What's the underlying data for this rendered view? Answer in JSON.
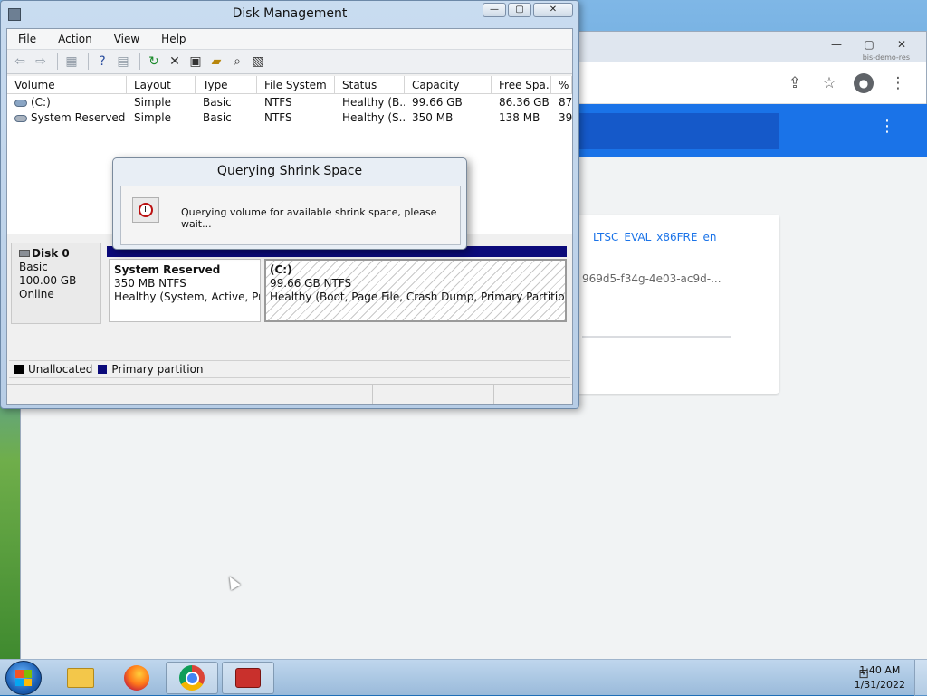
{
  "colors": {
    "unallocated": "#000000",
    "primary_partition": "#0b0a7a",
    "chrome_blue": "#1a73e8"
  },
  "chrome": {
    "window_buttons": [
      "—",
      "▢",
      "✕"
    ],
    "account_tag": "bis-demo-res",
    "toolbar_icons": [
      "share-icon",
      "star-icon",
      "account-icon",
      "more-icon"
    ],
    "banner_more": "⋮",
    "card": {
      "link_text": "_LTSC_EVAL_x86FRE_en",
      "id_text": "969d5-f34g-4e03-ac9d-..."
    }
  },
  "disk_management": {
    "title": "Disk Management",
    "window_buttons": [
      "—",
      "▢",
      "✕"
    ],
    "menu": [
      "File",
      "Action",
      "View",
      "Help"
    ],
    "toolbar_icons": [
      "back-icon",
      "forward-icon",
      "console-icon",
      "help-icon",
      "properties-icon",
      "refresh-icon",
      "delete-icon",
      "export-icon",
      "open-icon",
      "search-icon",
      "rescan-icon"
    ],
    "columns": [
      "Volume",
      "Layout",
      "Type",
      "File System",
      "Status",
      "Capacity",
      "Free Spa...",
      "% F"
    ],
    "volumes": [
      {
        "volume": "(C:)",
        "layout": "Simple",
        "type": "Basic",
        "fs": "NTFS",
        "status": "Healthy (B...",
        "capacity": "99.66 GB",
        "free": "86.36 GB",
        "pct": "87"
      },
      {
        "volume": "System Reserved",
        "layout": "Simple",
        "type": "Basic",
        "fs": "NTFS",
        "status": "Healthy (S...",
        "capacity": "350 MB",
        "free": "138 MB",
        "pct": "39"
      }
    ],
    "disk": {
      "name": "Disk 0",
      "kind": "Basic",
      "size": "100.00 GB",
      "state": "Online"
    },
    "partitions": [
      {
        "title": "System Reserved",
        "size": "350 MB NTFS",
        "status": "Healthy (System, Active, Prim"
      },
      {
        "title": "(C:)",
        "size": "99.66 GB NTFS",
        "status": "Healthy (Boot, Page File, Crash Dump, Primary Partition)"
      }
    ],
    "legend": [
      "Unallocated",
      "Primary partition"
    ]
  },
  "dialog": {
    "title": "Querying Shrink Space",
    "message": "Querying volume for available shrink space, please wait..."
  },
  "taskbar": {
    "apps": [
      "explorer-folder",
      "firefox",
      "chrome",
      "disk-management-toolbox"
    ],
    "active_app": "chrome",
    "time": "1:40 AM",
    "date": "1/31/2022"
  }
}
